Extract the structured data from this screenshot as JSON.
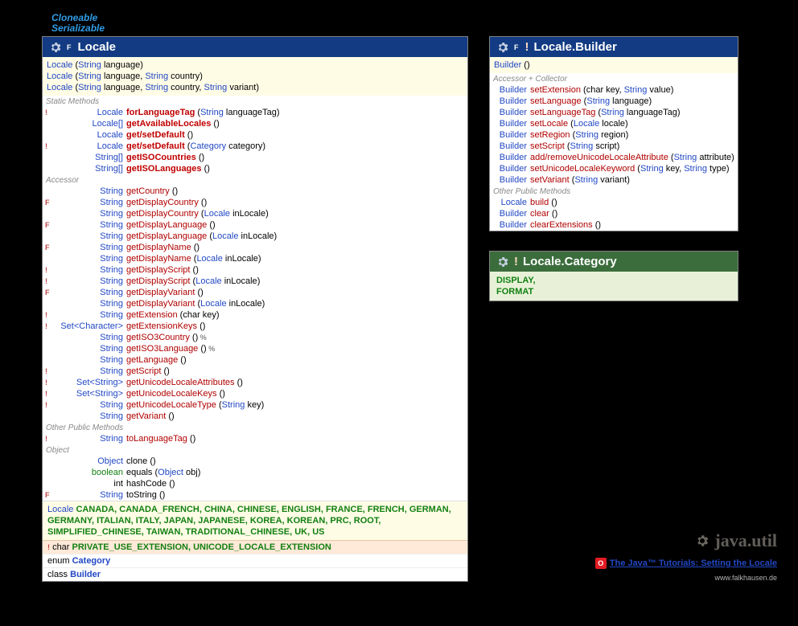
{
  "interfaces": [
    "Cloneable",
    "Serializable"
  ],
  "locale": {
    "title": "Locale",
    "modifier": "F",
    "constructors": [
      {
        "parts": [
          {
            "c": "t-blue",
            "t": "Locale "
          },
          {
            "c": "paren",
            "t": "("
          },
          {
            "c": "t-blue",
            "t": "String"
          },
          {
            "c": "t-black",
            "t": " language)"
          }
        ]
      },
      {
        "parts": [
          {
            "c": "t-blue",
            "t": "Locale "
          },
          {
            "c": "paren",
            "t": "("
          },
          {
            "c": "t-blue",
            "t": "String"
          },
          {
            "c": "t-black",
            "t": " language, "
          },
          {
            "c": "t-blue",
            "t": "String"
          },
          {
            "c": "t-black",
            "t": " country)"
          }
        ]
      },
      {
        "parts": [
          {
            "c": "t-blue",
            "t": "Locale "
          },
          {
            "c": "paren",
            "t": "("
          },
          {
            "c": "t-blue",
            "t": "String"
          },
          {
            "c": "t-black",
            "t": " language, "
          },
          {
            "c": "t-blue",
            "t": "String"
          },
          {
            "c": "t-black",
            "t": " country, "
          },
          {
            "c": "t-blue",
            "t": "String"
          },
          {
            "c": "t-black",
            "t": " variant)"
          }
        ]
      }
    ],
    "staticTitle": "Static Methods",
    "staticMethods": [
      {
        "badge": "!",
        "ret": "Locale",
        "name": "forLanguageTag",
        "bold": true,
        "args": [
          {
            "c": "t-blue",
            "t": "String"
          },
          {
            "c": "t-black",
            "t": " languageTag"
          }
        ]
      },
      {
        "badge": "",
        "ret": "Locale[]",
        "name": "getAvailableLocales",
        "bold": true,
        "args": []
      },
      {
        "badge": "",
        "ret": "Locale",
        "name": "get/setDefault",
        "bold": true,
        "args": []
      },
      {
        "badge": "!",
        "ret": "Locale",
        "name": "get/setDefault",
        "bold": true,
        "args": [
          {
            "c": "t-blue",
            "t": "Category"
          },
          {
            "c": "t-black",
            "t": " category"
          }
        ]
      },
      {
        "badge": "",
        "ret": "String[]",
        "name": "getISOCountries",
        "bold": true,
        "args": []
      },
      {
        "badge": "",
        "ret": "String[]",
        "name": "getISOLanguages",
        "bold": true,
        "args": []
      }
    ],
    "accessorTitle": "Accessor",
    "accessors": [
      {
        "badge": "",
        "ret": "String",
        "name": "getCountry",
        "args": []
      },
      {
        "badge": "F",
        "ret": "String",
        "name": "getDisplayCountry",
        "args": []
      },
      {
        "badge": "",
        "ret": "String",
        "name": "getDisplayCountry",
        "args": [
          {
            "c": "t-blue",
            "t": "Locale"
          },
          {
            "c": "t-black",
            "t": " inLocale"
          }
        ]
      },
      {
        "badge": "F",
        "ret": "String",
        "name": "getDisplayLanguage",
        "args": []
      },
      {
        "badge": "",
        "ret": "String",
        "name": "getDisplayLanguage",
        "args": [
          {
            "c": "t-blue",
            "t": "Locale"
          },
          {
            "c": "t-black",
            "t": " inLocale"
          }
        ]
      },
      {
        "badge": "F",
        "ret": "String",
        "name": "getDisplayName",
        "args": []
      },
      {
        "badge": "",
        "ret": "String",
        "name": "getDisplayName",
        "args": [
          {
            "c": "t-blue",
            "t": "Locale"
          },
          {
            "c": "t-black",
            "t": " inLocale"
          }
        ]
      },
      {
        "badge": "!",
        "ret": "String",
        "name": "getDisplayScript",
        "args": []
      },
      {
        "badge": "!",
        "ret": "String",
        "name": "getDisplayScript",
        "args": [
          {
            "c": "t-blue",
            "t": "Locale"
          },
          {
            "c": "t-black",
            "t": " inLocale"
          }
        ]
      },
      {
        "badge": "F",
        "ret": "String",
        "name": "getDisplayVariant",
        "args": []
      },
      {
        "badge": "",
        "ret": "String",
        "name": "getDisplayVariant",
        "args": [
          {
            "c": "t-blue",
            "t": "Locale"
          },
          {
            "c": "t-black",
            "t": " inLocale"
          }
        ]
      },
      {
        "badge": "!",
        "ret": "String",
        "name": "getExtension",
        "args": [
          {
            "c": "t-black",
            "t": "char key"
          }
        ]
      },
      {
        "badge": "! ",
        "ret": "Set<Character>",
        "name": "getExtensionKeys",
        "args": []
      },
      {
        "badge": "",
        "ret": "String",
        "name": "getISO3Country",
        "args": [],
        "suffix": " %"
      },
      {
        "badge": "",
        "ret": "String",
        "name": "getISO3Language",
        "args": [],
        "suffix": " %"
      },
      {
        "badge": "",
        "ret": "String",
        "name": "getLanguage",
        "args": []
      },
      {
        "badge": "!",
        "ret": "String",
        "name": "getScript",
        "args": []
      },
      {
        "badge": "!",
        "ret": "Set<String>",
        "name": "getUnicodeLocaleAttributes",
        "args": []
      },
      {
        "badge": "!",
        "ret": "Set<String>",
        "name": "getUnicodeLocaleKeys",
        "args": []
      },
      {
        "badge": "!",
        "ret": "String",
        "name": "getUnicodeLocaleType",
        "args": [
          {
            "c": "t-blue",
            "t": "String"
          },
          {
            "c": "t-black",
            "t": " key"
          }
        ]
      },
      {
        "badge": "",
        "ret": "String",
        "name": "getVariant",
        "args": []
      }
    ],
    "otherTitle": "Other Public Methods",
    "other": [
      {
        "badge": "!",
        "ret": "String",
        "name": "toLanguageTag",
        "args": []
      }
    ],
    "objectTitle": "Object",
    "objectMethods": [
      {
        "badge": "",
        "ret": "Object",
        "retColor": "t-blue",
        "name": "clone",
        "black": true,
        "args": []
      },
      {
        "badge": "",
        "ret": "boolean",
        "retColor": "t-green nb",
        "name": "equals",
        "black": true,
        "args": [
          {
            "c": "t-blue",
            "t": "Object"
          },
          {
            "c": "t-black",
            "t": " obj"
          }
        ]
      },
      {
        "badge": "",
        "ret": "int",
        "retColor": "t-black",
        "name": "hashCode",
        "black": true,
        "args": []
      },
      {
        "badge": "F",
        "ret": "String",
        "retColor": "t-blue",
        "name": "toString",
        "black": true,
        "args": []
      }
    ],
    "constants": {
      "type": "Locale",
      "values": "CANADA, CANADA_FRENCH, CHINA, CHINESE, ENGLISH, FRANCE, FRENCH, GERMAN, GERMANY, ITALIAN, ITALY, JAPAN, JAPANESE, KOREA, KOREAN, PRC, ROOT, SIMPLIFIED_CHINESE, TAIWAN, TRADITIONAL_CHINESE, UK, US"
    },
    "constants2": {
      "badge": "!",
      "type": "char",
      "values": "PRIVATE_USE_EXTENSION, UNICODE_LOCALE_EXTENSION"
    },
    "nested": [
      {
        "kw": "enum",
        "name": "Category"
      },
      {
        "kw": "class",
        "name": "Builder"
      }
    ]
  },
  "builder": {
    "modifier": "F",
    "bang": "!",
    "title": "Locale.Builder",
    "constructor": {
      "parts": [
        {
          "c": "t-blue",
          "t": "Builder "
        },
        {
          "c": "paren",
          "t": "()"
        }
      ]
    },
    "accessorTitle": "Accessor + Collector",
    "methods": [
      {
        "ret": "Builder",
        "name": "setExtension",
        "args": [
          {
            "c": "t-black",
            "t": "char key, "
          },
          {
            "c": "t-blue",
            "t": "String"
          },
          {
            "c": "t-black",
            "t": " value"
          }
        ]
      },
      {
        "ret": "Builder",
        "name": "setLanguage",
        "args": [
          {
            "c": "t-blue",
            "t": "String"
          },
          {
            "c": "t-black",
            "t": " language"
          }
        ]
      },
      {
        "ret": "Builder",
        "name": "setLanguageTag",
        "args": [
          {
            "c": "t-blue",
            "t": "String"
          },
          {
            "c": "t-black",
            "t": " languageTag"
          }
        ]
      },
      {
        "ret": "Builder",
        "name": "setLocale",
        "args": [
          {
            "c": "t-blue",
            "t": "Locale"
          },
          {
            "c": "t-black",
            "t": " locale"
          }
        ]
      },
      {
        "ret": "Builder",
        "name": "setRegion",
        "args": [
          {
            "c": "t-blue",
            "t": "String"
          },
          {
            "c": "t-black",
            "t": " region"
          }
        ]
      },
      {
        "ret": "Builder",
        "name": "setScript",
        "args": [
          {
            "c": "t-blue",
            "t": "String"
          },
          {
            "c": "t-black",
            "t": " script"
          }
        ]
      },
      {
        "ret": "Builder",
        "name": "add/removeUnicodeLocaleAttribute",
        "args": [
          {
            "c": "t-blue",
            "t": "String"
          },
          {
            "c": "t-black",
            "t": " attribute"
          }
        ]
      },
      {
        "ret": "Builder",
        "name": "setUnicodeLocaleKeyword",
        "args": [
          {
            "c": "t-blue",
            "t": "String"
          },
          {
            "c": "t-black",
            "t": " key, "
          },
          {
            "c": "t-blue",
            "t": "String"
          },
          {
            "c": "t-black",
            "t": " type"
          }
        ]
      },
      {
        "ret": "Builder",
        "name": "setVariant",
        "args": [
          {
            "c": "t-blue",
            "t": "String"
          },
          {
            "c": "t-black",
            "t": " variant"
          }
        ]
      }
    ],
    "otherTitle": "Other Public Methods",
    "other": [
      {
        "ret": "Locale",
        "name": "build",
        "args": []
      },
      {
        "ret": "Builder",
        "name": "clear",
        "args": []
      },
      {
        "ret": "Builder",
        "name": "clearExtensions",
        "args": []
      }
    ]
  },
  "category": {
    "bang": "!",
    "title": "Locale.Category",
    "values": "DISPLAY,\nFORMAT"
  },
  "footer": {
    "package": "java.util",
    "link": "The Java™ Tutorials: Setting the Locale",
    "copyright": "www.falkhausen.de"
  }
}
